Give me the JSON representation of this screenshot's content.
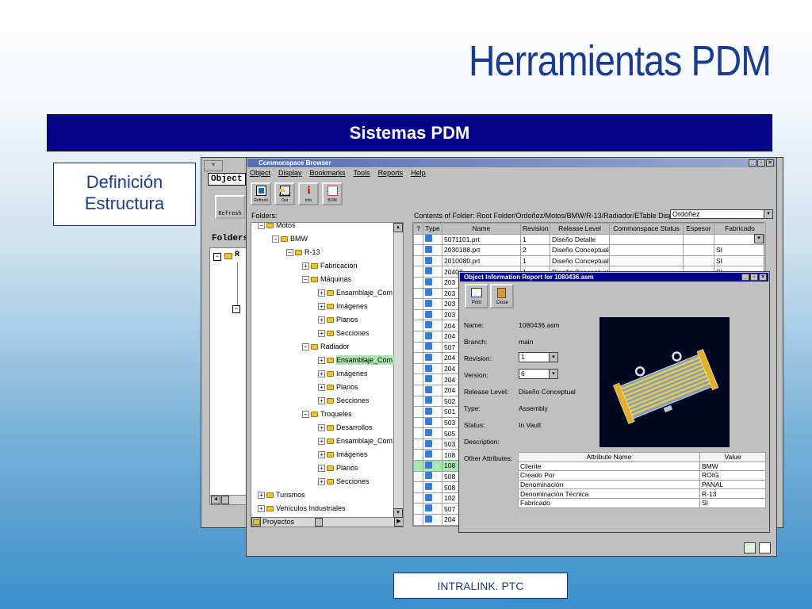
{
  "slide": {
    "title": "Herramientas PDM",
    "banner": "Sistemas PDM",
    "definition_line1": "Definición",
    "definition_line2": "Estructura",
    "footer": "INTRALINK. PTC"
  },
  "back_window": {
    "menu_label": "Object",
    "refresh_label": "Refresh",
    "folders_label": "Folders:",
    "tree_initial": "R"
  },
  "main_window": {
    "title": "Commonspace Browser",
    "menu": [
      "Object",
      "Display",
      "Bookmarks",
      "Tools",
      "Reports",
      "Help"
    ],
    "toolbar": [
      {
        "label": "Refresh",
        "icon": "refresh-icon"
      },
      {
        "label": "Check Out",
        "icon": "check-out-icon"
      },
      {
        "label": "Info",
        "icon": "info-icon"
      },
      {
        "label": "BOM",
        "icon": "bom-icon"
      }
    ],
    "folders_label": "Folders:",
    "contents_label": "Contents of Folder:  Root Folder/Ordoñez/Motos/BMW/R-13/Radiador/ETable Display: r",
    "display_combo": "Ordóñez",
    "tree": [
      {
        "label": "Motos",
        "level": 0,
        "sign": "−"
      },
      {
        "label": "BMW",
        "level": 1,
        "sign": "−"
      },
      {
        "label": "R-13",
        "level": 2,
        "sign": "−"
      },
      {
        "label": "Fabricación",
        "level": 3,
        "sign": "+"
      },
      {
        "label": "Máquinas",
        "level": 3,
        "sign": "−"
      },
      {
        "label": "Ensamblaje_Com",
        "level": 4,
        "sign": "+"
      },
      {
        "label": "Imágenes",
        "level": 4,
        "sign": "+"
      },
      {
        "label": "Planos",
        "level": 4,
        "sign": "+"
      },
      {
        "label": "Secciones",
        "level": 4,
        "sign": "+"
      },
      {
        "label": "Radiador",
        "level": 3,
        "sign": "−"
      },
      {
        "label": "Ensamblaje_Com",
        "level": 4,
        "sign": "+",
        "selected": true
      },
      {
        "label": "Imágenes",
        "level": 4,
        "sign": "+"
      },
      {
        "label": "Planos",
        "level": 4,
        "sign": "+"
      },
      {
        "label": "Secciones",
        "level": 4,
        "sign": "+"
      },
      {
        "label": "Troqueles",
        "level": 3,
        "sign": "−"
      },
      {
        "label": "Desarrollos",
        "level": 4,
        "sign": "+"
      },
      {
        "label": "Ensamblaje_Com",
        "level": 4,
        "sign": "+"
      },
      {
        "label": "Imágenes",
        "level": 4,
        "sign": "+"
      },
      {
        "label": "Planos",
        "level": 4,
        "sign": "+"
      },
      {
        "label": "Secciones",
        "level": 4,
        "sign": "+"
      },
      {
        "label": "Turismos",
        "level": 0,
        "sign": "+"
      },
      {
        "label": "Vehículos Industriales",
        "level": 0,
        "sign": "+"
      },
      {
        "label": "Proyectos",
        "level": -1,
        "sign": ""
      }
    ],
    "columns": [
      "?",
      "Type",
      "Name",
      "Revision",
      "Release Level",
      "Commonspace Status",
      "Espesor",
      "Fabricado"
    ],
    "rows": [
      {
        "name": "5071101.prt",
        "rev": "1",
        "level": "Diseño Detalle",
        "status": "",
        "esp": "",
        "fab": ""
      },
      {
        "name": "2030188.prt",
        "rev": "2",
        "level": "Diseño Conceptual",
        "status": "",
        "esp": "",
        "fab": "SI"
      },
      {
        "name": "2010080.prt",
        "rev": "1",
        "level": "Diseño Conceptual",
        "status": "",
        "esp": "",
        "fab": "SI"
      },
      {
        "name": "20402...",
        "rev": "1",
        "level": "Diseño Conceptual",
        "status": "",
        "esp": "",
        "fab": "SI"
      },
      {
        "name": "203"
      },
      {
        "name": "203"
      },
      {
        "name": "203"
      },
      {
        "name": "203"
      },
      {
        "name": "204"
      },
      {
        "name": "204"
      },
      {
        "name": "507"
      },
      {
        "name": "204"
      },
      {
        "name": "204"
      },
      {
        "name": "204"
      },
      {
        "name": "204"
      },
      {
        "name": "502"
      },
      {
        "name": "501"
      },
      {
        "name": "503"
      },
      {
        "name": "505"
      },
      {
        "name": "503"
      },
      {
        "name": "108"
      },
      {
        "name": "108",
        "hl": true
      },
      {
        "name": "508"
      },
      {
        "name": "508"
      },
      {
        "name": "102"
      },
      {
        "name": "507"
      },
      {
        "name": "204"
      }
    ]
  },
  "dialog": {
    "title": "Object Information Report for 1080436.asm",
    "print_label": "Print",
    "close_label": "Close",
    "fields": {
      "name_label": "Name:",
      "name_value": "1080436.asm",
      "branch_label": "Branch:",
      "branch_value": "main",
      "revision_label": "Revision:",
      "revision_value": "1",
      "version_label": "Version:",
      "version_value": "6",
      "release_label": "Release Level:",
      "release_value": "Diseño Conceptual",
      "type_label": "Type:",
      "type_value": "Assembly",
      "status_label": "Status:",
      "status_value": "In Vault",
      "description_label": "Description:",
      "other_label": "Other Attributes:"
    },
    "attr_columns": [
      "Attribute Name",
      "Value"
    ],
    "attributes": [
      {
        "name": "Cliente",
        "value": "BMW"
      },
      {
        "name": "Creado Por",
        "value": "ROIG"
      },
      {
        "name": "Denominación",
        "value": "PANAL"
      },
      {
        "name": "Denominación Técnica",
        "value": "R-13"
      },
      {
        "name": "Fabricado",
        "value": "SI"
      }
    ]
  },
  "colors": {
    "title_blue": "#1a3b8f",
    "banner_bg": "#05058a",
    "selection_green": "#a9e6b0",
    "folder_yellow": "#e8c23a"
  }
}
